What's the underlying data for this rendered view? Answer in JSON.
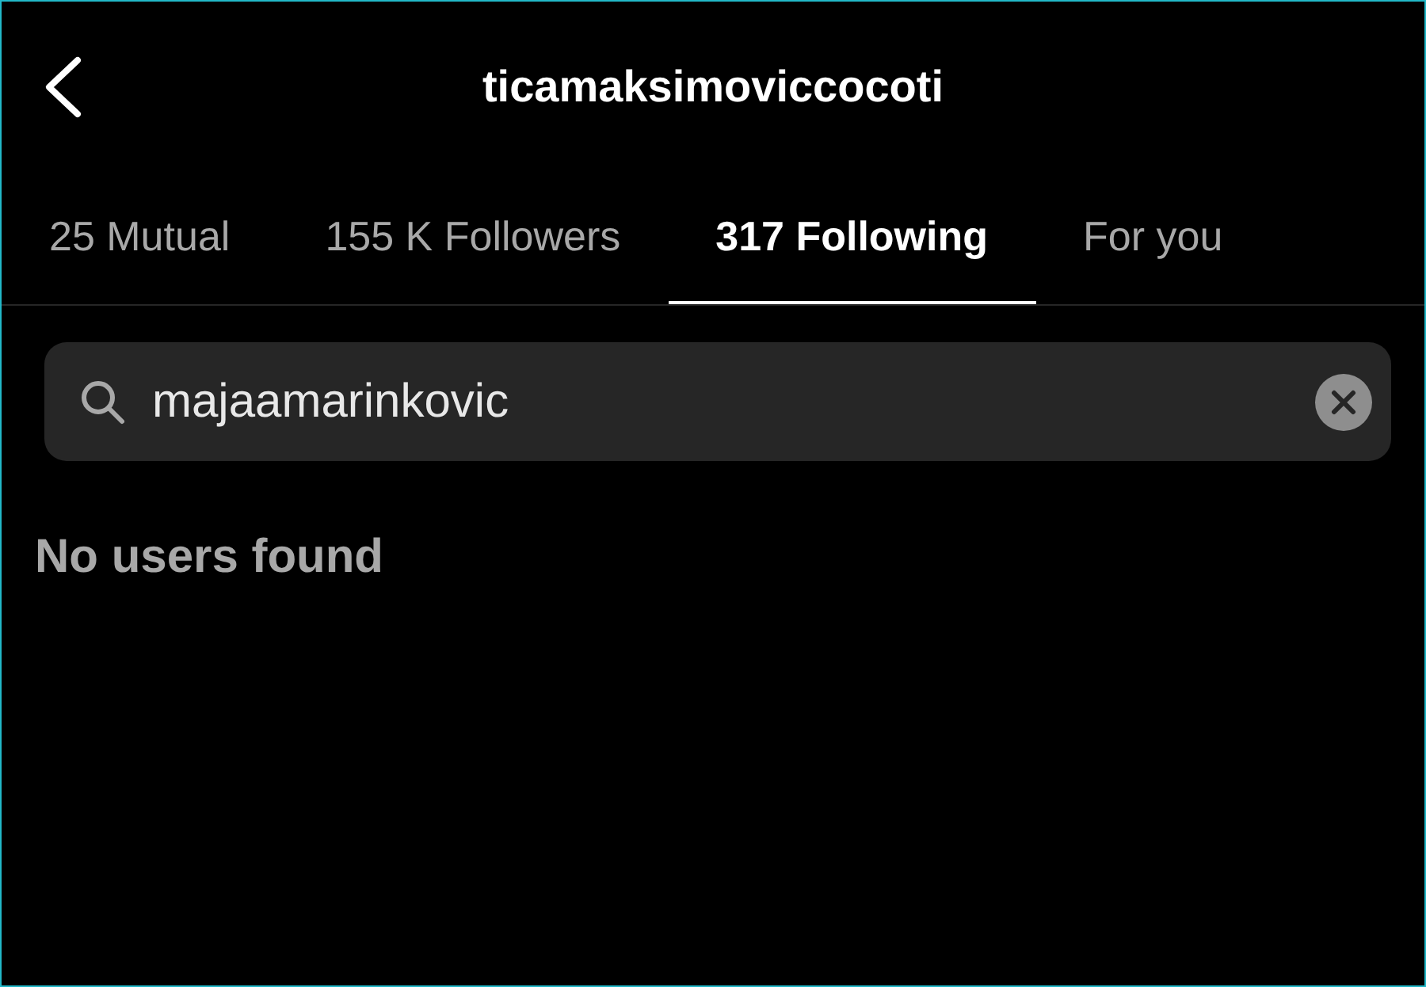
{
  "header": {
    "title": "ticamaksimoviccocoti"
  },
  "tabs": [
    {
      "label": "25 Mutual",
      "selected": false
    },
    {
      "label": "155 K Followers",
      "selected": false
    },
    {
      "label": "317 Following",
      "selected": true
    },
    {
      "label": "For you",
      "selected": false
    }
  ],
  "search": {
    "value": "majaamarinkovic"
  },
  "message": "No users found"
}
